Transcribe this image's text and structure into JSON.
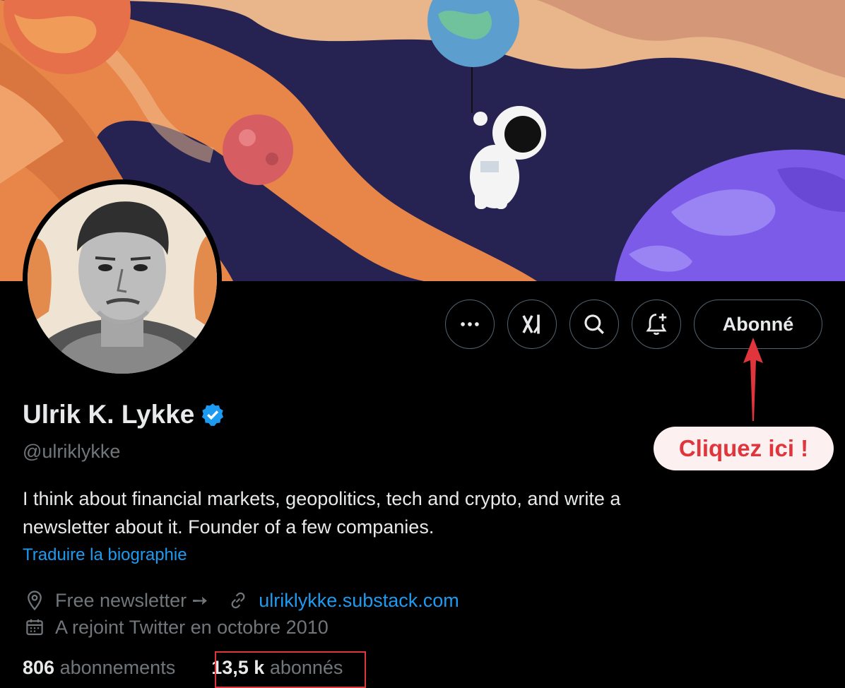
{
  "profile": {
    "name": "Ulrik K. Lykke",
    "handle": "@ulriklykke",
    "bio_line1": "I think about financial markets, geopolitics, tech and crypto, and write a",
    "bio_line2": "newsletter about it. Founder of a few companies.",
    "translate_label": "Traduire la biographie",
    "location": "Free newsletter ➙",
    "website": "ulriklykke.substack.com",
    "joined": "A rejoint Twitter en octobre 2010",
    "following_count": "806",
    "following_label": "abonnements",
    "followers_count": "13,5 k",
    "followers_label": "abonnés"
  },
  "actions": {
    "more_icon": "more-dots-icon",
    "grok_icon": "grok-icon",
    "search_icon": "search-icon",
    "notify_icon": "bell-plus-icon",
    "follow_label": "Abonné"
  },
  "annotation": {
    "callout_text": "Cliquez ici !",
    "color": "#e0353d"
  },
  "colors": {
    "accent": "#1d9bf0",
    "verified": "#1d9bf0",
    "muted": "#71767b",
    "border": "#536471",
    "background": "#000000"
  }
}
